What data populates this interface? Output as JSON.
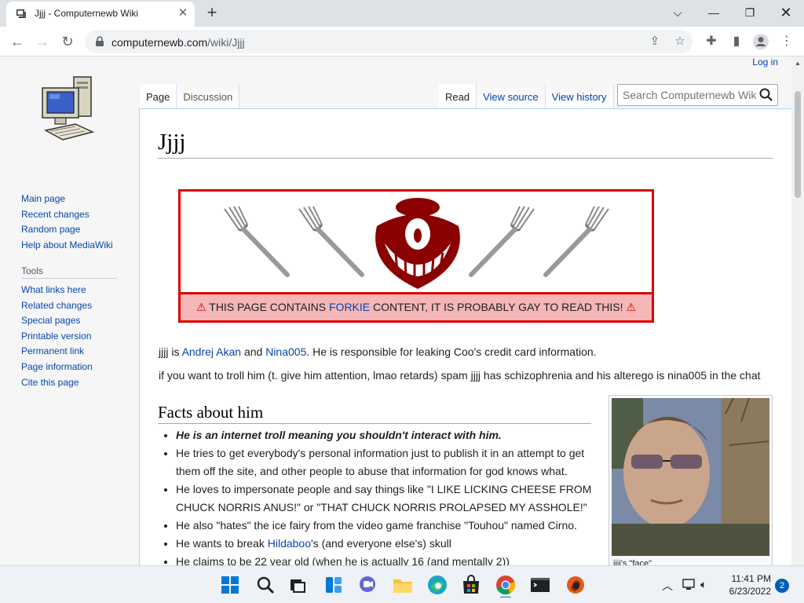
{
  "browser": {
    "tab_title": "Jjjj - Computernewb Wiki",
    "url_host": "computernewb.com",
    "url_path": "/wiki/Jjjj"
  },
  "wiki": {
    "login": "Log in",
    "tabs_left": [
      "Page",
      "Discussion"
    ],
    "tabs_right": [
      "Read",
      "View source",
      "View history"
    ],
    "search_placeholder": "Search Computernewb Wiki",
    "nav": [
      "Main page",
      "Recent changes",
      "Random page",
      "Help about MediaWiki"
    ],
    "tools_heading": "Tools",
    "tools": [
      "What links here",
      "Related changes",
      "Special pages",
      "Printable version",
      "Permanent link",
      "Page information",
      "Cite this page"
    ],
    "title": "Jjjj",
    "warning": {
      "prefix": "THIS PAGE CONTAINS ",
      "link": "FORKIE",
      "suffix": " CONTENT, IT IS PROBABLY GAY TO READ THIS!"
    },
    "intro": {
      "p1_a": "jjjj is ",
      "p1_link1": "Andrej Akan",
      "p1_b": " and ",
      "p1_link2": "Nina005",
      "p1_c": ". He is responsible for leaking Coo's credit card information.",
      "p2": "if you want to troll him (t. give him attention, lmao retards) spam jjjj has schizophrenia and his alterego is nina005 in the chat"
    },
    "section_title": "Facts about him",
    "facts": {
      "f1": "He is an internet troll meaning you shouldn't interact with him.",
      "f2": "He tries to get everybody's personal information just to publish it in an attempt to get them off the site, and other people to abuse that information for god knows what.",
      "f3": "He loves to impersonate people and say things like \"I LIKE LICKING CHEESE FROM CHUCK NORRIS ANUS!\" or \"THAT CHUCK NORRIS PROLAPSED MY ASSHOLE!\"",
      "f4": "He also \"hates\" the ice fairy from the video game franchise \"Touhou\" named Cirno.",
      "f5_a": "He wants to break ",
      "f5_link": "Hildaboo",
      "f5_b": "'s (and everyone else's) skull",
      "f6": "He claims to be 22 year old (when he is actually 16 (and mentally 2))"
    },
    "thumb_caption": "jjjj's \"face\""
  },
  "taskbar": {
    "time": "11:41 PM",
    "date": "6/23/2022",
    "notifications": "2"
  }
}
